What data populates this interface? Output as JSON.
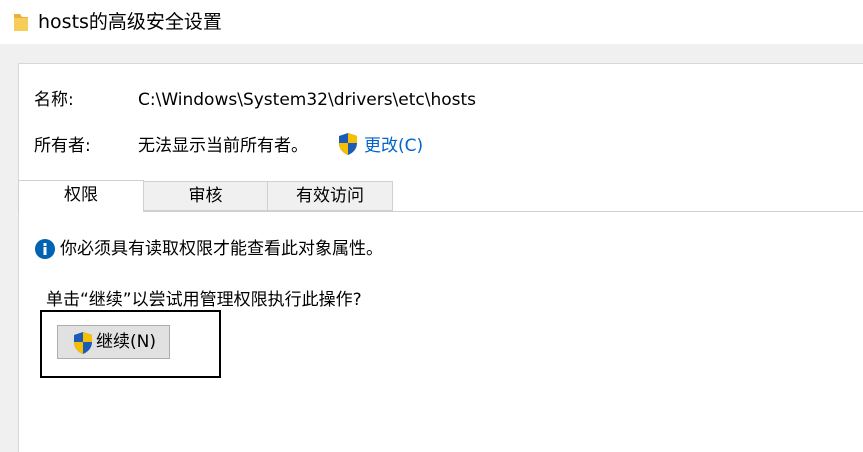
{
  "window": {
    "title": "hosts的高级安全设置",
    "folder_icon": "folder-icon"
  },
  "properties": {
    "name_label": "名称:",
    "name_value": "C:\\Windows\\System32\\drivers\\etc\\hosts",
    "owner_label": "所有者:",
    "owner_value": "无法显示当前所有者。",
    "change_link": "更改(C)",
    "change_icon": "uac-shield-icon"
  },
  "tabs": [
    {
      "label": "权限",
      "active": true
    },
    {
      "label": "审核",
      "active": false
    },
    {
      "label": "有效访问",
      "active": false
    }
  ],
  "content": {
    "info_icon": "info-icon",
    "info_message": "你必须具有读取权限才能查看此对象属性。",
    "prompt": "单击“继续”以尝试用管理权限执行此操作?",
    "continue_button": "继续(N)",
    "continue_icon": "uac-shield-icon"
  },
  "colors": {
    "link": "#0066cc",
    "info_blue": "#0063b1",
    "shield_blue": "#1c5bb8",
    "shield_yellow": "#f6c000"
  }
}
